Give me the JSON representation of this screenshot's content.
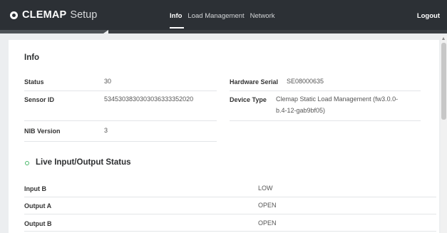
{
  "header": {
    "brand_name": "CLEMAP",
    "brand_suffix": "Setup",
    "tabs": [
      {
        "label": "Info",
        "active": true
      },
      {
        "label": "Load Management",
        "active": false
      },
      {
        "label": "Network",
        "active": false
      }
    ],
    "logout_label": "Logout",
    "icon": "clemap-logo-icon"
  },
  "info": {
    "title": "Info",
    "fields": {
      "status_label": "Status",
      "status_value": "30",
      "sensor_label": "Sensor ID",
      "sensor_value": "5345303830303036333352020",
      "nib_label": "NIB Version",
      "nib_value": "3",
      "hw_label": "Hardware Serial",
      "hw_value": "SE08000635",
      "device_label": "Device Type",
      "device_value_line1": "Clemap Static Load Management (fw3.0.0-",
      "device_value_line2": "b.4-12-gab9bf05)"
    }
  },
  "live": {
    "title": "Live Input/Output Status",
    "icon": "status-dot-icon",
    "accent_color": "#49b86a",
    "rows": [
      {
        "label": "Input B",
        "value": "LOW"
      },
      {
        "label": "Output A",
        "value": "OPEN"
      },
      {
        "label": "Output B",
        "value": "OPEN"
      }
    ]
  },
  "colors": {
    "topbar": "#2c3035",
    "page_bg": "#eceef0",
    "card_bg": "#ffffff"
  }
}
